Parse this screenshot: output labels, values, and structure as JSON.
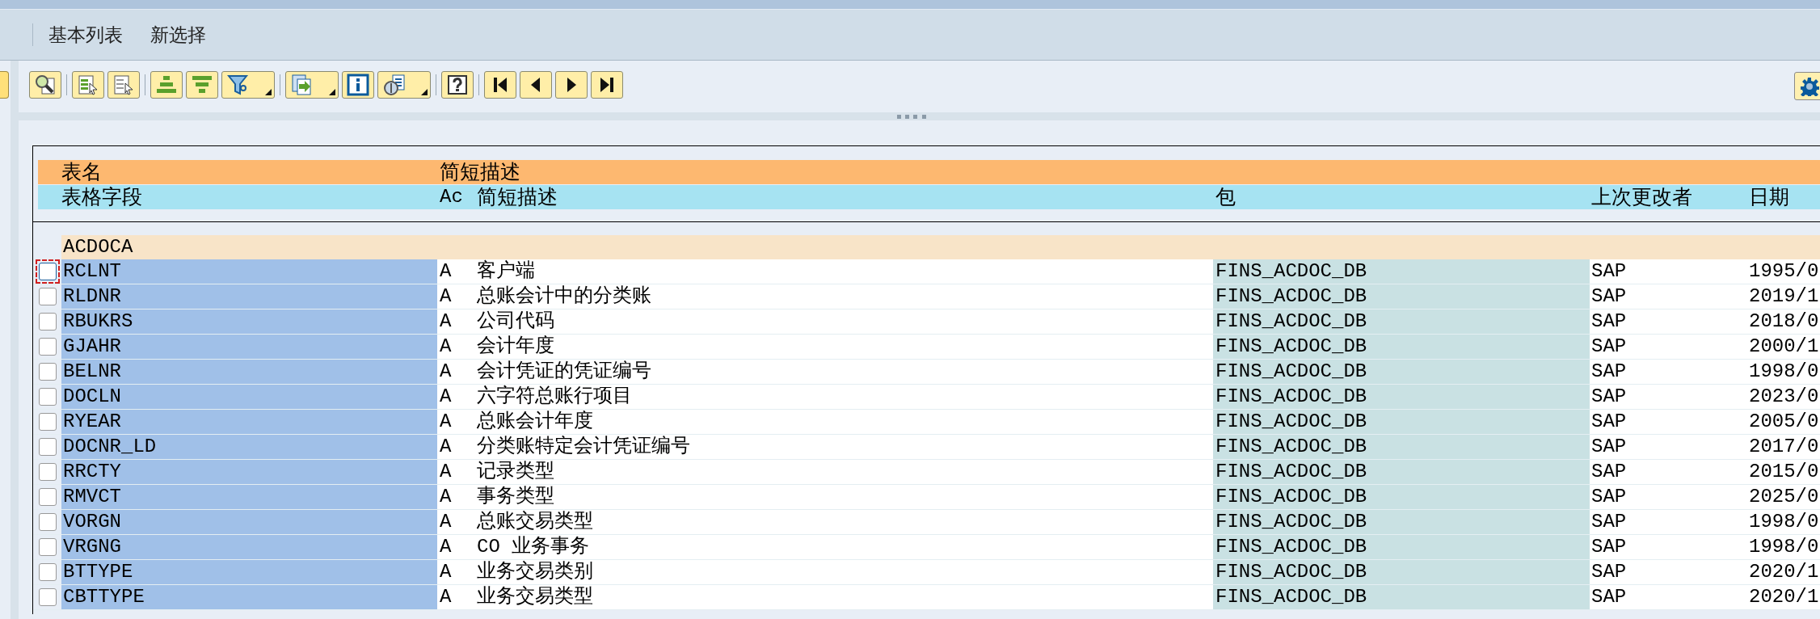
{
  "menu": [
    {
      "label": "基本列表"
    },
    {
      "label": "新选择"
    }
  ],
  "table": {
    "header_rows": [
      [
        "表名",
        "",
        "简短描述",
        "",
        "",
        ""
      ],
      [
        "表格字段",
        "Ac",
        "简短描述",
        "包",
        "上次更改者",
        "日期"
      ]
    ],
    "group": "ACDOCA",
    "rows": [
      {
        "field": "RCLNT",
        "ac": "A",
        "description": "客户端",
        "package": "FINS_ACDOC_DB",
        "changed_by": "SAP",
        "date": "1995/0",
        "checked": false,
        "focused": true
      },
      {
        "field": "RLDNR",
        "ac": "A",
        "description": "总账会计中的分类账",
        "package": "FINS_ACDOC_DB",
        "changed_by": "SAP",
        "date": "2019/1",
        "checked": false,
        "focused": false
      },
      {
        "field": "RBUKRS",
        "ac": "A",
        "description": "公司代码",
        "package": "FINS_ACDOC_DB",
        "changed_by": "SAP",
        "date": "2018/0",
        "checked": false,
        "focused": false
      },
      {
        "field": "GJAHR",
        "ac": "A",
        "description": "会计年度",
        "package": "FINS_ACDOC_DB",
        "changed_by": "SAP",
        "date": "2000/1",
        "checked": false,
        "focused": false
      },
      {
        "field": "BELNR",
        "ac": "A",
        "description": "会计凭证的凭证编号",
        "package": "FINS_ACDOC_DB",
        "changed_by": "SAP",
        "date": "1998/0",
        "checked": false,
        "focused": false
      },
      {
        "field": "DOCLN",
        "ac": "A",
        "description": "六字符总账行项目",
        "package": "FINS_ACDOC_DB",
        "changed_by": "SAP",
        "date": "2023/0",
        "checked": false,
        "focused": false
      },
      {
        "field": "RYEAR",
        "ac": "A",
        "description": "总账会计年度",
        "package": "FINS_ACDOC_DB",
        "changed_by": "SAP",
        "date": "2005/0",
        "checked": false,
        "focused": false
      },
      {
        "field": "DOCNR_LD",
        "ac": "A",
        "description": "分类账特定会计凭证编号",
        "package": "FINS_ACDOC_DB",
        "changed_by": "SAP",
        "date": "2017/0",
        "checked": false,
        "focused": false
      },
      {
        "field": "RRCTY",
        "ac": "A",
        "description": "记录类型",
        "package": "FINS_ACDOC_DB",
        "changed_by": "SAP",
        "date": "2015/0",
        "checked": false,
        "focused": false
      },
      {
        "field": "RMVCT",
        "ac": "A",
        "description": "事务类型",
        "package": "FINS_ACDOC_DB",
        "changed_by": "SAP",
        "date": "2025/0",
        "checked": false,
        "focused": false
      },
      {
        "field": "VORGN",
        "ac": "A",
        "description": "总账交易类型",
        "package": "FINS_ACDOC_DB",
        "changed_by": "SAP",
        "date": "1998/0",
        "checked": false,
        "focused": false
      },
      {
        "field": "VRGNG",
        "ac": "A",
        "description": "CO 业务事务",
        "package": "FINS_ACDOC_DB",
        "changed_by": "SAP",
        "date": "1998/0",
        "checked": false,
        "focused": false
      },
      {
        "field": "BTTYPE",
        "ac": "A",
        "description": "业务交易类别",
        "package": "FINS_ACDOC_DB",
        "changed_by": "SAP",
        "date": "2020/1",
        "checked": false,
        "focused": false
      },
      {
        "field": "CBTTYPE",
        "ac": "A",
        "description": "业务交易类型",
        "package": "FINS_ACDOC_DB",
        "changed_by": "SAP",
        "date": "2020/1",
        "checked": false,
        "focused": false
      }
    ]
  }
}
